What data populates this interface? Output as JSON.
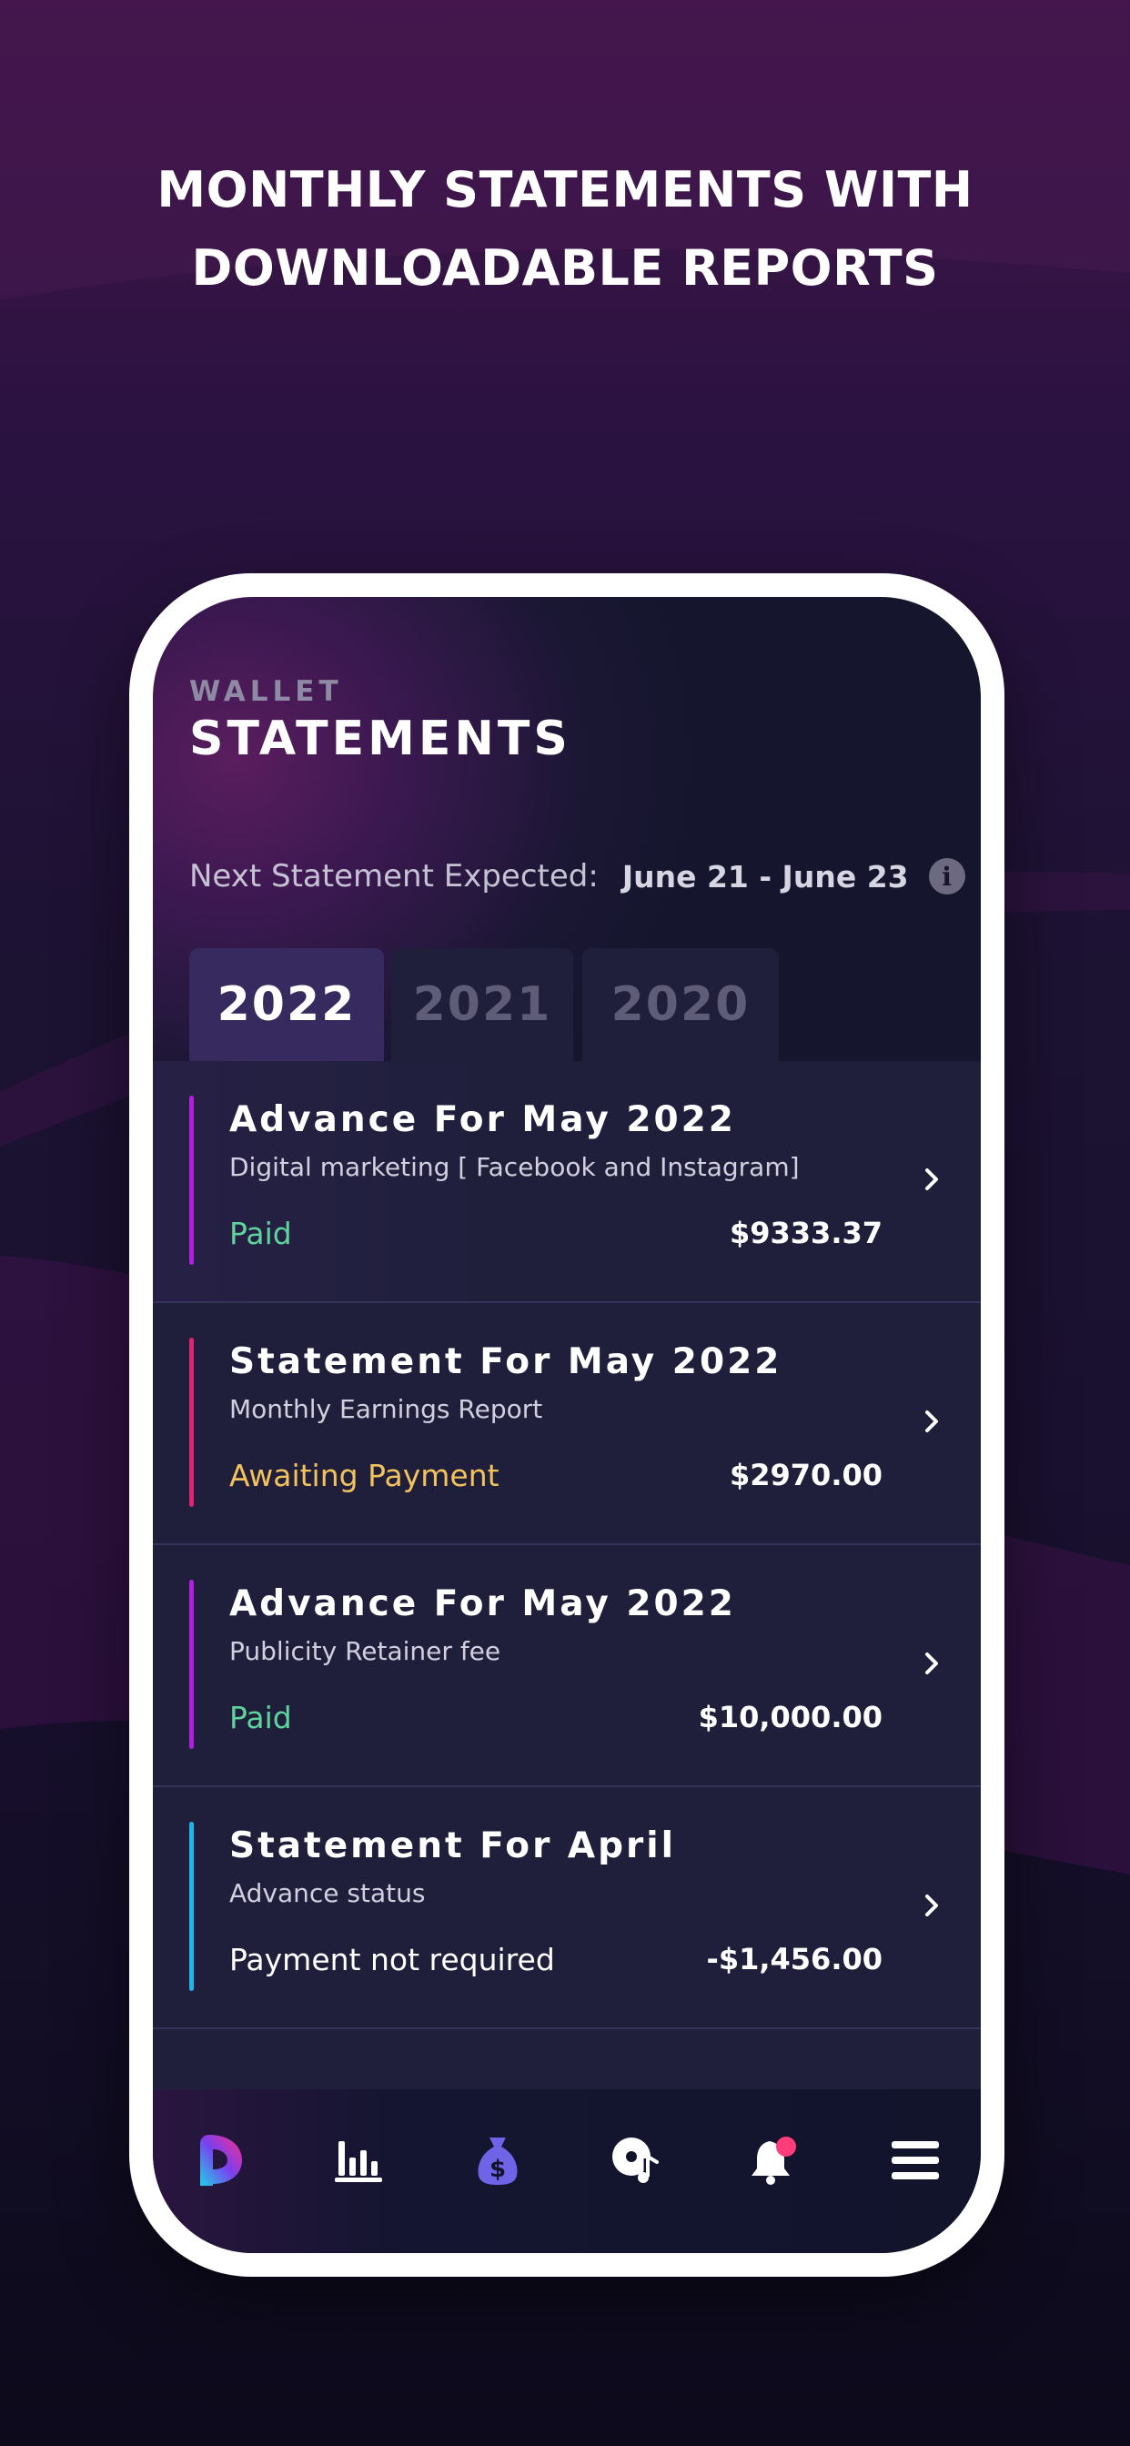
{
  "headline": {
    "line1": "MONTHLY STATEMENTS WITH",
    "line2": "DOWNLOADABLE REPORTS"
  },
  "header": {
    "section_label": "WALLET",
    "title": "STATEMENTS"
  },
  "next_statement": {
    "label": "Next Statement Expected:",
    "dates": "June 21 - June 23",
    "info_glyph": "i"
  },
  "year_tabs": [
    {
      "label": "2022",
      "active": true
    },
    {
      "label": "2021",
      "active": false
    },
    {
      "label": "2020",
      "active": false
    }
  ],
  "statements": [
    {
      "title": "Advance For May 2022",
      "subtitle": "Digital marketing [ Facebook and Instagram]",
      "status": "Paid",
      "amount": "$9333.37",
      "accent_color": "#b11fe0",
      "status_color": "#5fd39b"
    },
    {
      "title": "Statement For May 2022",
      "subtitle": "Monthly Earnings Report",
      "status": "Awaiting Payment",
      "amount": "$2970.00",
      "accent_color": "#e0246f",
      "status_color": "#f2c25c"
    },
    {
      "title": "Advance For May 2022",
      "subtitle": "Publicity Retainer fee",
      "status": "Paid",
      "amount": "$10,000.00",
      "accent_color": "#b11fe0",
      "status_color": "#5fd39b"
    },
    {
      "title": "Statement For April",
      "subtitle": "Advance status",
      "status": "Payment not required",
      "amount": "-$1,456.00",
      "accent_color": "#1fb5e8",
      "status_color": "#ffffff"
    }
  ],
  "bottom_nav": [
    {
      "icon": "app-logo-icon"
    },
    {
      "icon": "bar-chart-icon"
    },
    {
      "icon": "money-bag-icon"
    },
    {
      "icon": "music-disc-icon"
    },
    {
      "icon": "bell-notification-icon"
    },
    {
      "icon": "hamburger-menu-icon"
    }
  ],
  "colors": {
    "accent_purple": "#b11fe0",
    "accent_pink": "#e0246f",
    "accent_cyan": "#1fb5e8",
    "paid_green": "#5fd39b",
    "awaiting_yellow": "#f2c25c",
    "nav_bag": "#6f63e8",
    "notification_dot": "#ff3d7a"
  }
}
